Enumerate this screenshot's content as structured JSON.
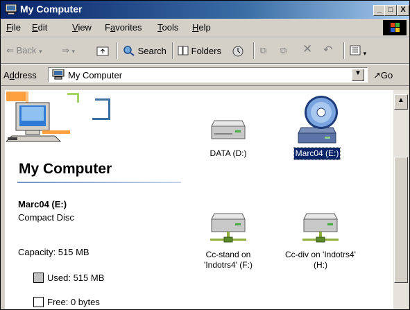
{
  "window": {
    "title": "My Computer",
    "minimize_glyph": "_",
    "maximize_glyph": "□",
    "close_glyph": "X"
  },
  "menu": {
    "items": [
      {
        "label": "File",
        "accel": "F",
        "rest": "ile"
      },
      {
        "label": "Edit",
        "accel": "E",
        "rest": "dit"
      },
      {
        "label": "View",
        "accel": "V",
        "rest": "iew"
      },
      {
        "label": "Favorites",
        "accel": "a",
        "pre": "F",
        "rest": "vorites"
      },
      {
        "label": "Tools",
        "accel": "T",
        "rest": "ools"
      },
      {
        "label": "Help",
        "accel": "H",
        "rest": "elp"
      }
    ]
  },
  "toolbar": {
    "back_label": "Back",
    "search_label": "Search",
    "folders_label": "Folders"
  },
  "address": {
    "label_pre": "A",
    "label_accel": "d",
    "label_rest": "dress",
    "value": "My Computer",
    "go_label": "Go"
  },
  "left_panel": {
    "title": "My Computer",
    "selected_name": "Marc04 (E:)",
    "selected_type": "Compact Disc",
    "capacity": "Capacity: 515 MB",
    "used": "Used: 515 MB",
    "free": "Free: 0 bytes"
  },
  "icons": [
    {
      "label": "DATA (D:)",
      "kind": "hard-drive",
      "selected": false
    },
    {
      "label": "Marc04 (E:)",
      "kind": "cd-drive",
      "selected": true
    },
    {
      "label_line1": "Cc-stand on",
      "label_line2": "'Indotrs4' (F:)",
      "kind": "network-drive",
      "selected": false
    },
    {
      "label_line1": "Cc-div on 'Indotrs4'",
      "label_line2": "(H:)",
      "kind": "network-drive",
      "selected": false
    }
  ]
}
